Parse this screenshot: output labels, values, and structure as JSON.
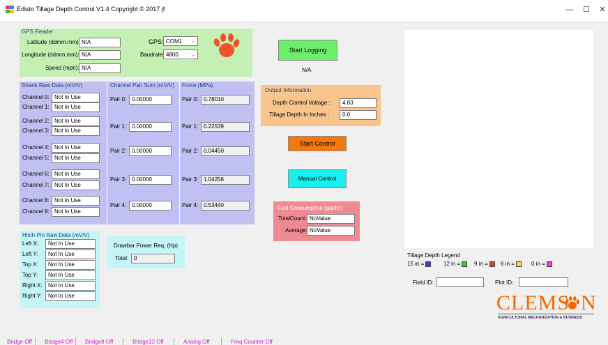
{
  "window": {
    "title": "Edisto Tillage Depth Control  V1.4  Copyright © 2017 jf",
    "minimize": "—",
    "maximize": "☐",
    "close": "✕"
  },
  "gps": {
    "heading": "GPS Reader",
    "lat_label": "Latitude (ddmm.mm):",
    "lat_value": "N/A",
    "lon_label": "Longitude (ddmm.mm):",
    "lon_value": "N/A",
    "speed_label": "Speed (mph):",
    "speed_value": "N/A",
    "port_label": "GPS:",
    "port_value": "COM1",
    "baud_label": "Baudrate:",
    "baud_value": "4800"
  },
  "logging": {
    "button": "Start Logging",
    "status": "N/A"
  },
  "shank": {
    "heading": "Shank Raw Data (mV/V)",
    "channels": [
      {
        "label": "Channel 0:",
        "value": "Not In Use"
      },
      {
        "label": "Channel 1:",
        "value": "Not In Use"
      },
      {
        "label": "Channel 2:",
        "value": "Not In Use"
      },
      {
        "label": "Channel 3:",
        "value": "Not In Use"
      },
      {
        "label": "Channel 4:",
        "value": "Not In Use"
      },
      {
        "label": "Channel 5:",
        "value": "Not In Use"
      },
      {
        "label": "Channel 6:",
        "value": "Not In Use"
      },
      {
        "label": "Channel 7:",
        "value": "Not In Use"
      },
      {
        "label": "Channel 8:",
        "value": "Not In Use"
      },
      {
        "label": "Channel 9:",
        "value": "Not In Use"
      }
    ]
  },
  "pairs": {
    "heading": "Channel Pair Sum (mV/V)",
    "items": [
      {
        "label": "Pair 0:",
        "value": "0.00000"
      },
      {
        "label": "Pair 1:",
        "value": "0.00000"
      },
      {
        "label": "Pair 2:",
        "value": "0.00000"
      },
      {
        "label": "Pair 3:",
        "value": "0.00000"
      },
      {
        "label": "Pair 4:",
        "value": "0.00000"
      }
    ]
  },
  "force": {
    "heading": "Force (MPa)",
    "items": [
      {
        "label": "Pair 0:",
        "value": "0.78010"
      },
      {
        "label": "Pair 1:",
        "value": "0.22539"
      },
      {
        "label": "Pair 2:",
        "value": "0.04450"
      },
      {
        "label": "Pair 3:",
        "value": "1.04258"
      },
      {
        "label": "Pair 4:",
        "value": "0.53440"
      }
    ]
  },
  "output": {
    "heading": "Output Information",
    "voltage_label": "Depth Control Voltage :",
    "voltage_value": "4.83",
    "depth_label": "Tillage Depth In Inches :",
    "depth_value": "0.0"
  },
  "control": {
    "start": "Start Control",
    "manual": "Manual Control"
  },
  "fuel": {
    "heading": "Fuel Consumption (gal/hr)",
    "total_label": "TotalCount:",
    "total_value": "NoValue",
    "avg_label": "Average:",
    "avg_value": "NoValue"
  },
  "hitch": {
    "heading": "Hitch Pin Raw Data (mV/V)",
    "items": [
      {
        "label": "Left X:",
        "value": "Not In Use"
      },
      {
        "label": "Left Y:",
        "value": "Not In Use"
      },
      {
        "label": "Top X:",
        "value": "Not In Use"
      },
      {
        "label": "Top Y:",
        "value": "Not In Use"
      },
      {
        "label": "Right X:",
        "value": "Not In Use"
      },
      {
        "label": "Right Y:",
        "value": "Not In Use"
      }
    ]
  },
  "drawbar": {
    "heading": "Drawbar Power Req. (Hp)",
    "total_label": "Total:",
    "total_value": "0"
  },
  "legend": {
    "heading": "Tillage Depth Legend",
    "items": [
      {
        "label": "15 in =",
        "color": "#3a3adf"
      },
      {
        "label": "12 in =",
        "color": "#3fbf3f"
      },
      {
        "label": "9 in =",
        "color": "#e03a3a"
      },
      {
        "label": "6 in =",
        "color": "#f0e040"
      },
      {
        "label": "0 in =",
        "color": "#e040e0"
      }
    ]
  },
  "ids": {
    "field_label": "Field ID:",
    "field_value": "",
    "plot_label": "Plot ID:",
    "plot_value": ""
  },
  "logo": {
    "name": "CLEMS",
    "name_end": "N",
    "sub": "AGRICULTURAL MECHANIZATION & BUSINESS",
    "color": "#f56600"
  },
  "status": [
    "Bridge Off",
    "Bridge4 Off",
    "Bridge8 Off",
    "Bridge12 Off",
    "Analog Off",
    "Freq Counter  Off"
  ],
  "colors": {
    "gps_panel": "#c5f0b4",
    "shank_panel": "#c0c0f2",
    "output_panel": "#f9c58d",
    "fuel_panel": "#ef8a93",
    "hitch_panel": "#c6f5f8",
    "logging_btn": "#6cf06c",
    "start_btn": "#f5780a",
    "manual_btn": "#18f0f0"
  }
}
